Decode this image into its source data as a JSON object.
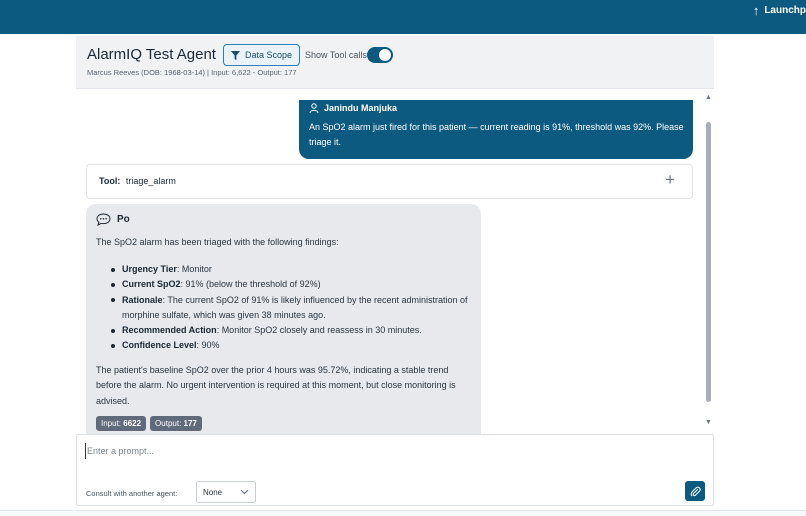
{
  "app": {
    "launch_label": "Launchp"
  },
  "header": {
    "title": "AlarmIQ Test Agent",
    "data_scope_label": "Data Scope",
    "show_tool_calls_label": "Show Tool calls",
    "show_tool_calls_on": true,
    "subtitle": "Marcus Reeves (DOB: 1968-03-14)  | Input: 6,622 - Output: 177"
  },
  "messages": {
    "user": {
      "name": "Janindu Manjuka",
      "text": "An SpO2 alarm just fired for this patient — current reading is 91%, threshold was 92%. Please triage it."
    },
    "tool": {
      "label": "Tool:",
      "name": "triage_alarm"
    },
    "assistant": {
      "name": "Po",
      "intro": "The SpO2 alarm has been triaged with the following findings:",
      "findings": [
        {
          "key": "Urgency Tier",
          "value": ": Monitor"
        },
        {
          "key": "Current SpO2",
          "value": ": 91% (below the threshold of 92%)"
        },
        {
          "key": "Rationale",
          "value": ": The current SpO2 of 91% is likely influenced by the recent administration of morphine sulfate, which was given 38 minutes ago."
        },
        {
          "key": "Recommended Action",
          "value": ": Monitor SpO2 closely and reassess in 30 minutes."
        },
        {
          "key": "Confidence Level",
          "value": ": 90%"
        }
      ],
      "summary": "The patient's baseline SpO2 over the prior 4 hours was 95.72%, indicating a stable trend before the alarm. No urgent intervention is required at this moment, but close monitoring is advised.",
      "input_label": "Input: ",
      "input_tokens": "6622",
      "output_label": "Output: ",
      "output_tokens": "177"
    }
  },
  "composer": {
    "placeholder": "Enter a prompt...",
    "value": "",
    "consult_label": "Consult with another agent:",
    "agent_selected": "None"
  },
  "colors": {
    "brand": "#0c5a80",
    "assistant_bubble": "#e8e9ec",
    "token_badge": "#5f6b7a"
  }
}
